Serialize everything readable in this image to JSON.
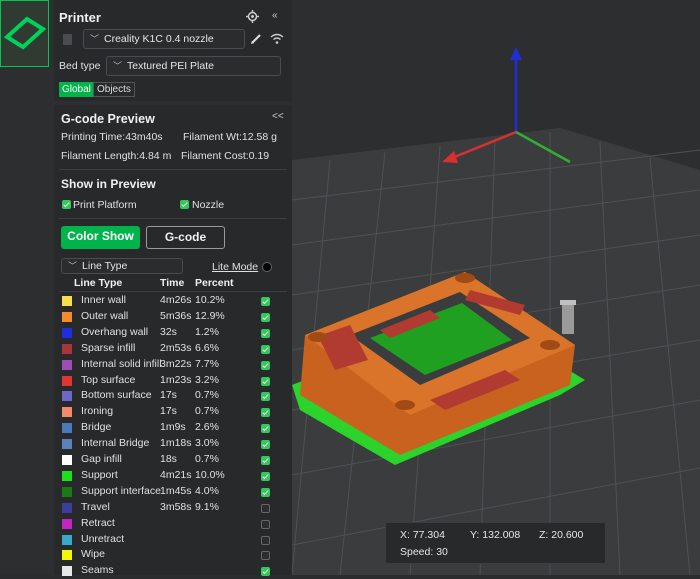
{
  "printer": {
    "title": "Printer",
    "settings_icon": "gear-icon",
    "collapse_icon": "double-chevron-left-icon",
    "printer_name": "Creality K1C 0.4 nozzle",
    "bed_type_label": "Bed type",
    "bed_type_value": "Textured PEI Plate",
    "tabs": [
      "Global",
      "Objects"
    ]
  },
  "gcode_preview": {
    "title": "G-code Preview",
    "collapse_label": "<<",
    "printing_time": "Printing Time:43m40s",
    "filament_wt": "Filament Wt:12.58 g",
    "filament_length": "Filament Length:4.84 m",
    "filament_cost": "Filament Cost:0.19",
    "show_in_preview_title": "Show in Preview",
    "print_platform_label": "Print Platform",
    "nozzle_label": "Nozzle",
    "color_show_label": "Color Show",
    "gcode_label": "G-code",
    "line_type_select": "Line Type",
    "lite_mode_label": "Lite Mode"
  },
  "table": {
    "headers": [
      "Line Type",
      "Time",
      "Percent"
    ],
    "rows": [
      {
        "name": "Inner wall",
        "time": "4m26s",
        "percent": "10.2%",
        "color": "#f5e04a",
        "checked": true
      },
      {
        "name": "Outer wall",
        "time": "5m36s",
        "percent": "12.9%",
        "color": "#f28a30",
        "checked": true
      },
      {
        "name": "Overhang wall",
        "time": "32s",
        "percent": "1.2%",
        "color": "#1f2de0",
        "checked": true
      },
      {
        "name": "Sparse infill",
        "time": "2m53s",
        "percent": "6.6%",
        "color": "#a8353a",
        "checked": true
      },
      {
        "name": "Internal solid infill",
        "time": "3m22s",
        "percent": "7.7%",
        "color": "#9b4fb5",
        "checked": true
      },
      {
        "name": "Top surface",
        "time": "1m23s",
        "percent": "3.2%",
        "color": "#e03535",
        "checked": true
      },
      {
        "name": "Bottom surface",
        "time": "17s",
        "percent": "0.7%",
        "color": "#6c67c9",
        "checked": true
      },
      {
        "name": "Ironing",
        "time": "17s",
        "percent": "0.7%",
        "color": "#f58a6a",
        "checked": true
      },
      {
        "name": "Bridge",
        "time": "1m9s",
        "percent": "2.6%",
        "color": "#4d79b8",
        "checked": true
      },
      {
        "name": "Internal Bridge",
        "time": "1m18s",
        "percent": "3.0%",
        "color": "#5a83b7",
        "checked": true
      },
      {
        "name": "Gap infill",
        "time": "18s",
        "percent": "0.7%",
        "color": "#ffffff",
        "checked": true
      },
      {
        "name": "Support",
        "time": "4m21s",
        "percent": "10.0%",
        "color": "#1de01d",
        "checked": true
      },
      {
        "name": "Support interface",
        "time": "1m45s",
        "percent": "4.0%",
        "color": "#1a7a1a",
        "checked": true
      },
      {
        "name": "Travel",
        "time": "3m58s",
        "percent": "9.1%",
        "color": "#3b3f9a",
        "checked": false
      },
      {
        "name": "Retract",
        "time": "",
        "percent": "",
        "color": "#c026c0",
        "checked": false
      },
      {
        "name": "Unretract",
        "time": "",
        "percent": "",
        "color": "#3aa8c8",
        "checked": false
      },
      {
        "name": "Wipe",
        "time": "",
        "percent": "",
        "color": "#f5f50a",
        "checked": false
      },
      {
        "name": "Seams",
        "time": "",
        "percent": "",
        "color": "#e8e8e8",
        "checked": true
      }
    ]
  },
  "hud": {
    "x": "X: 77.304",
    "y": "Y: 132.008",
    "z": "Z: 20.600",
    "speed": "Speed: 30"
  },
  "colors": {
    "accent": "#00c853",
    "panel": "#27292b",
    "viewport": "#2b2c2e"
  }
}
